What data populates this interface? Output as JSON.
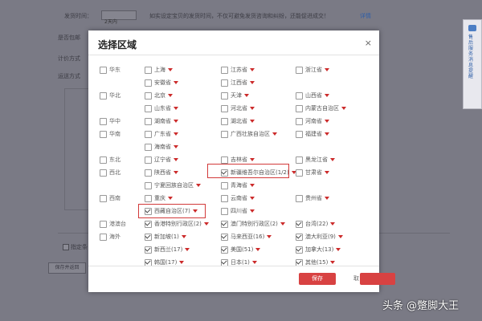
{
  "background": {
    "send_time_label": "发货时间：",
    "send_time_value": "2天内",
    "send_time_hint": "如实设定宝贝的发货时间，不仅可避免发货咨询和纠纷，还能促进成交！",
    "send_time_link": "详情",
    "free_shipping_label": "是否包邮",
    "pricing_label": "计价方式",
    "shipping_label": "运送方式",
    "assign_label": "指定条",
    "save_return_button": "保存并返回",
    "side_panel_text": "售后服务消息提醒"
  },
  "modal": {
    "title": "选择区域",
    "close": "×",
    "save_button": "保存",
    "cancel_button": "取"
  },
  "regions": [
    {
      "name": "华东",
      "checked": false,
      "cells": [
        {
          "label": "上海",
          "checked": false
        },
        {
          "label": "江苏省",
          "checked": false
        },
        {
          "label": "浙江省",
          "checked": false
        }
      ]
    },
    {
      "name": "",
      "checked": false,
      "cells": [
        {
          "label": "安徽省",
          "checked": false
        },
        {
          "label": "江西省",
          "checked": false
        }
      ]
    },
    {
      "name": "华北",
      "checked": false,
      "cells": [
        {
          "label": "北京",
          "checked": false
        },
        {
          "label": "天津",
          "checked": false
        },
        {
          "label": "山西省",
          "checked": false
        }
      ]
    },
    {
      "name": "",
      "checked": false,
      "cells": [
        {
          "label": "山东省",
          "checked": false
        },
        {
          "label": "河北省",
          "checked": false
        },
        {
          "label": "内蒙古自治区",
          "checked": false
        }
      ]
    },
    {
      "name": "华中",
      "checked": false,
      "cells": [
        {
          "label": "湖南省",
          "checked": false
        },
        {
          "label": "湖北省",
          "checked": false
        },
        {
          "label": "河南省",
          "checked": false
        }
      ]
    },
    {
      "name": "华南",
      "checked": false,
      "cells": [
        {
          "label": "广东省",
          "checked": false
        },
        {
          "label": "广西壮族自治区",
          "checked": false
        },
        {
          "label": "福建省",
          "checked": false
        }
      ]
    },
    {
      "name": "",
      "checked": false,
      "cells": [
        {
          "label": "海南省",
          "checked": false
        }
      ]
    },
    {
      "name": "东北",
      "checked": false,
      "cells": [
        {
          "label": "辽宁省",
          "checked": false
        },
        {
          "label": "吉林省",
          "checked": false
        },
        {
          "label": "黑龙江省",
          "checked": false
        }
      ]
    },
    {
      "name": "西北",
      "checked": false,
      "cells": [
        {
          "label": "陕西省",
          "checked": false
        },
        {
          "label": "新疆维吾尔自治区(1/2)",
          "checked": true,
          "highlight": true
        },
        {
          "label": "甘肃省",
          "checked": false
        }
      ]
    },
    {
      "name": "",
      "checked": false,
      "cells": [
        {
          "label": "宁夏回族自治区",
          "checked": false
        },
        {
          "label": "青海省",
          "checked": false
        }
      ]
    },
    {
      "name": "西南",
      "checked": false,
      "cells": [
        {
          "label": "重庆",
          "checked": false
        },
        {
          "label": "云南省",
          "checked": false
        },
        {
          "label": "贵州省",
          "checked": false
        }
      ]
    },
    {
      "name": "",
      "checked": false,
      "cells": [
        {
          "label": "西藏自治区(7)",
          "checked": true,
          "highlight": true
        },
        {
          "label": "四川省",
          "checked": false
        }
      ]
    },
    {
      "name": "港澳台",
      "checked": false,
      "cells": [
        {
          "label": "香港特别行政区(2)",
          "checked": true
        },
        {
          "label": "澳门特别行政区(2)",
          "checked": true
        },
        {
          "label": "台湾(22)",
          "checked": true
        }
      ]
    },
    {
      "name": "海外",
      "checked": false,
      "cells": [
        {
          "label": "新加坡(1)",
          "checked": true
        },
        {
          "label": "马来西亚(16)",
          "checked": true
        },
        {
          "label": "澳大利亚(9)",
          "checked": true
        }
      ]
    },
    {
      "name": "",
      "checked": false,
      "cells": [
        {
          "label": "新西兰(17)",
          "checked": true
        },
        {
          "label": "美国(51)",
          "checked": true
        },
        {
          "label": "加拿大(13)",
          "checked": true
        }
      ]
    },
    {
      "name": "",
      "checked": false,
      "cells": [
        {
          "label": "韩国(17)",
          "checked": true
        },
        {
          "label": "日本(1)",
          "checked": true
        },
        {
          "label": "其他(15)",
          "checked": true
        }
      ]
    }
  ],
  "watermark": "头条 @蹩脚大王"
}
